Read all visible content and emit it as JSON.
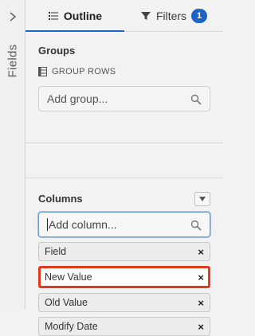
{
  "rail": {
    "label": "Fields",
    "chevron_icon": "chevron-right-icon"
  },
  "tabs": [
    {
      "label": "Outline",
      "icon": "list-icon",
      "active": true
    },
    {
      "label": "Filters",
      "icon": "filter-icon",
      "badge": "1",
      "active": false
    }
  ],
  "groups": {
    "title": "Groups",
    "sub_label": "GROUP ROWS",
    "sub_icon": "rows-icon",
    "input_placeholder": "Add group..."
  },
  "columns": {
    "title": "Columns",
    "input_placeholder": "Add column...",
    "items": [
      {
        "label": "Field",
        "remove": "×",
        "selected": false
      },
      {
        "label": "New Value",
        "remove": "×",
        "selected": true
      },
      {
        "label": "Old Value",
        "remove": "×",
        "selected": false
      },
      {
        "label": "Modify Date",
        "remove": "×",
        "selected": false
      }
    ]
  },
  "colors": {
    "accent": "#1b64c4",
    "highlight": "#e23a1d"
  }
}
